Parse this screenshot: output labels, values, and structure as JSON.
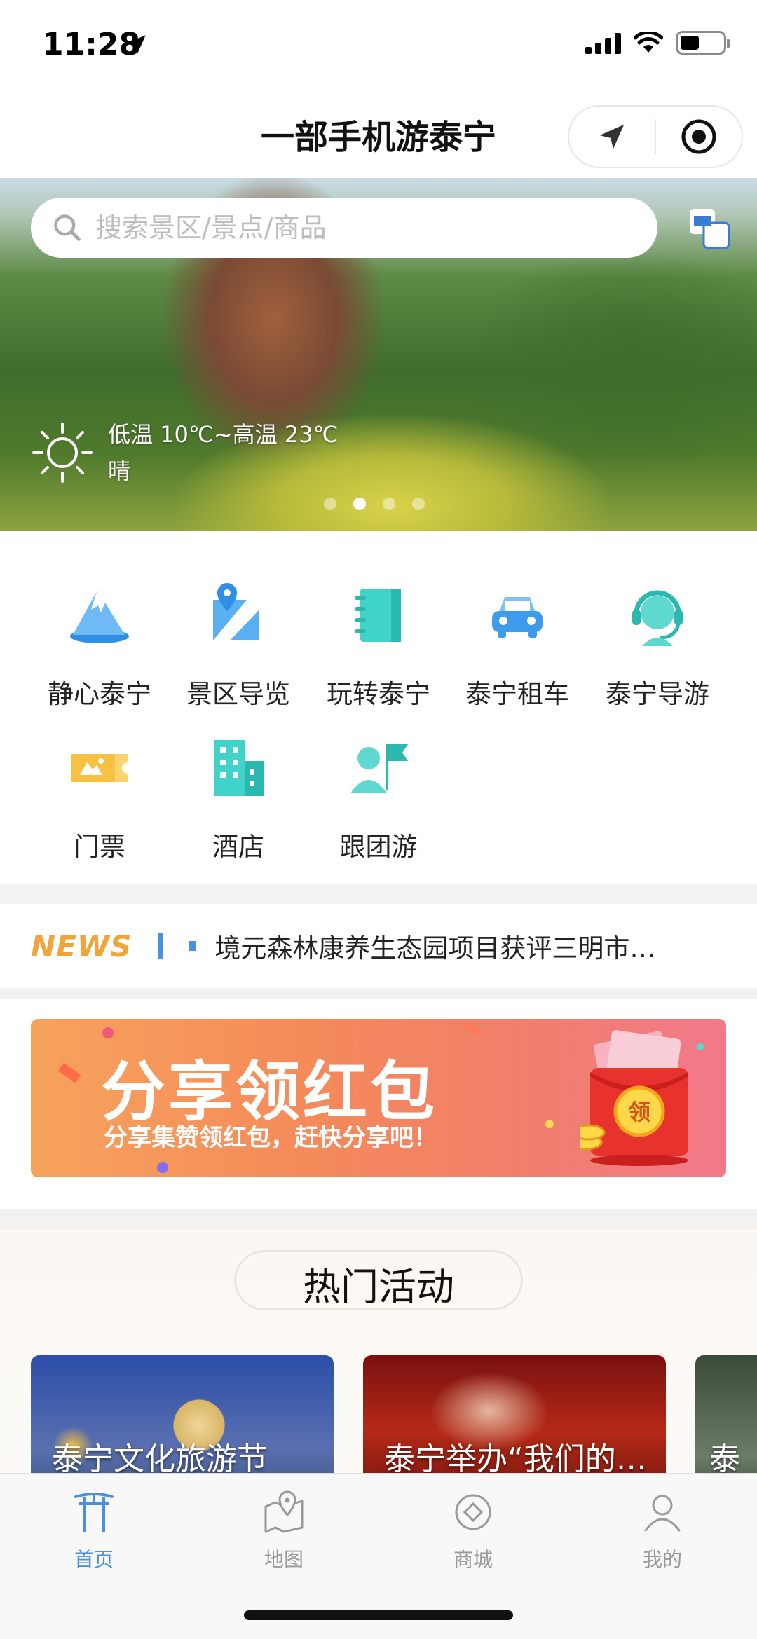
{
  "status_bar": {
    "time": "11:28",
    "icons": [
      "location-arrow-icon",
      "signal-icon",
      "wifi-icon",
      "battery-icon"
    ]
  },
  "header": {
    "title": "一部手机游泰宁",
    "buttons": [
      "navigate-icon",
      "record-icon"
    ]
  },
  "banner": {
    "search_placeholder": "搜索景区/景点/商品",
    "weather": {
      "temp": "低温 10℃~高温 23℃",
      "condition": "晴"
    },
    "slides": 4,
    "active_slide": 2
  },
  "features": [
    {
      "label": "静心泰宁",
      "icon": "mountain-icon",
      "color": "#4aa3f0"
    },
    {
      "label": "景区导览",
      "icon": "map-guide-icon",
      "color": "#4aa3f0"
    },
    {
      "label": "玩转泰宁",
      "icon": "notebook-icon",
      "color": "#3ecfc9"
    },
    {
      "label": "泰宁租车",
      "icon": "car-icon",
      "color": "#4aa3f0"
    },
    {
      "label": "泰宁导游",
      "icon": "headset-guide-icon",
      "color": "#3ecfc9"
    },
    {
      "label": "门票",
      "icon": "ticket-icon",
      "color": "#f5c24a"
    },
    {
      "label": "酒店",
      "icon": "hotel-icon",
      "color": "#3ecfc9"
    },
    {
      "label": "跟团游",
      "icon": "group-tour-icon",
      "color": "#3ecfc9"
    }
  ],
  "news": {
    "logo": "NEWS",
    "headline": "境元森林康养生态园项目获评三明市…"
  },
  "promo": {
    "title": "分享领红包",
    "subtitle": "分享集赞领红包，赶快分享吧！",
    "envelope_text": "领"
  },
  "hot_activities": {
    "title": "热门活动",
    "cards": [
      {
        "label": "泰宁文化旅游节"
      },
      {
        "label": "泰宁举办“我们的…"
      },
      {
        "label": "泰"
      }
    ]
  },
  "tabbar": {
    "items": [
      {
        "label": "首页",
        "icon": "home-gate-icon",
        "active": true
      },
      {
        "label": "地图",
        "icon": "map-pin-icon",
        "active": false
      },
      {
        "label": "商城",
        "icon": "shop-icon",
        "active": false
      },
      {
        "label": "我的",
        "icon": "user-icon",
        "active": false
      }
    ],
    "active_color": "#4a90e2",
    "inactive_color": "#999999"
  }
}
